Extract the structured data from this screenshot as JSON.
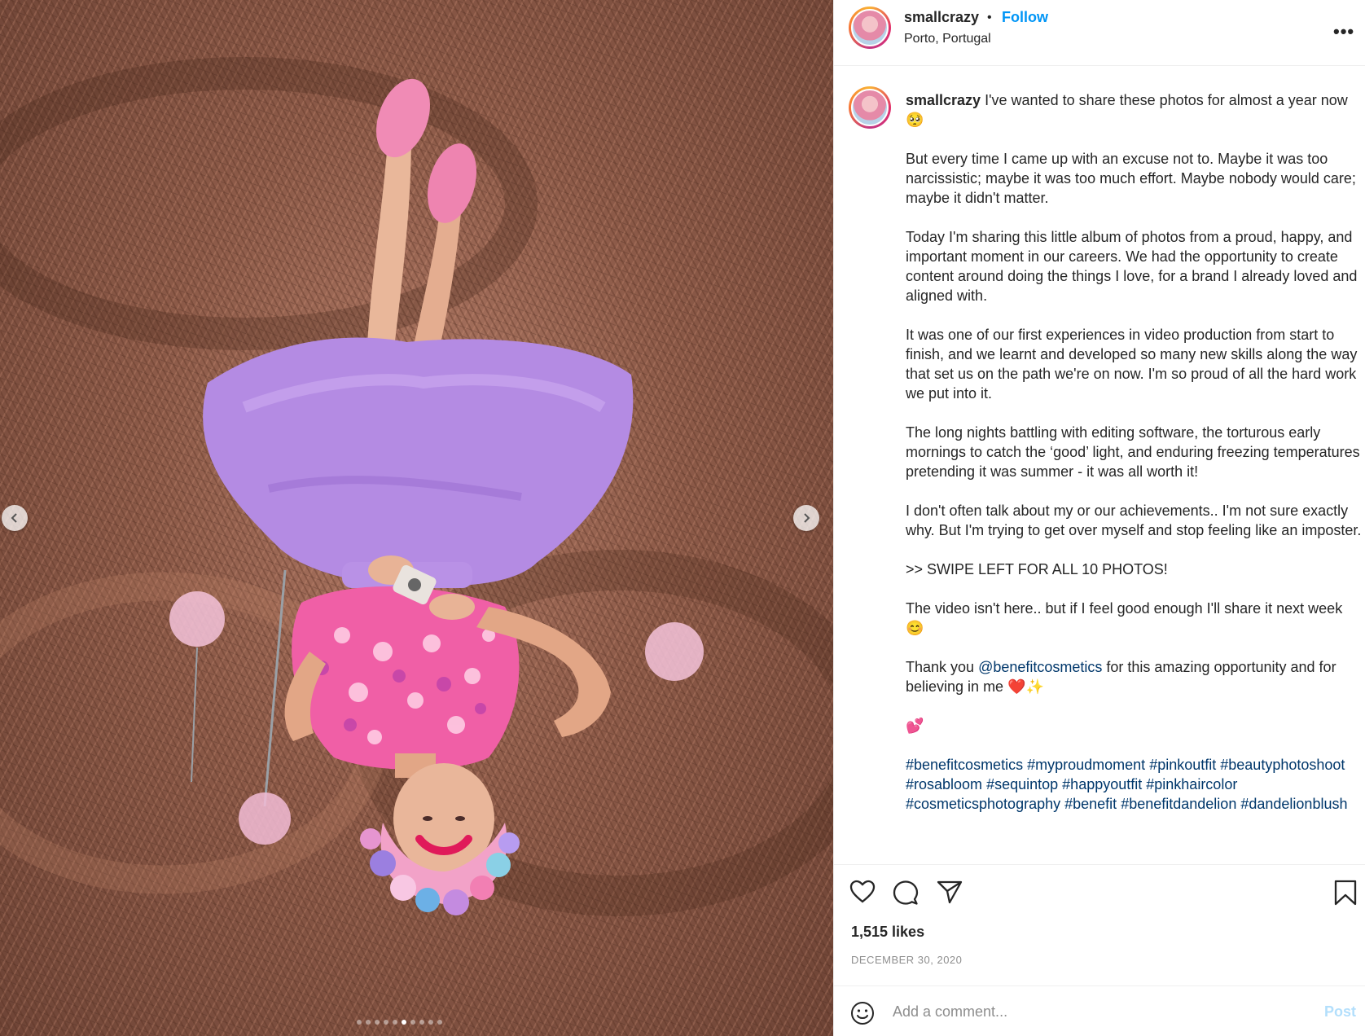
{
  "post": {
    "username": "smallcrazy",
    "separator": "•",
    "follow_label": "Follow",
    "location": "Porto, Portugal",
    "more_label": "•••",
    "caption": {
      "username": "smallcrazy",
      "paragraphs": [
        "I've wanted to share these photos for almost a year now 🥺",
        "But every time I came up with an excuse not to. Maybe it was too narcissistic; maybe it was too much effort. Maybe nobody would care; maybe it didn't matter.",
        "Today I'm sharing this little album of photos from a proud, happy, and important moment in our careers. We had the opportunity to create content around doing the things I love, for a brand I already loved and aligned with.",
        "It was one of our first experiences in video production from start to finish, and we learnt and developed so many new skills along the way that set us on the path we're on now. I'm so proud of all the hard work we put into it.",
        "The long nights battling with editing software, the torturous early mornings to catch the ‘good’ light, and enduring freezing temperatures pretending it was summer - it was all worth it!",
        "I don't often talk about my or our achievements.. I'm not sure exactly why. But I'm trying to get over myself and stop feeling like an imposter.",
        ">> SWIPE LEFT FOR ALL 10 PHOTOS!",
        "The video isn't here.. but if I feel good enough I'll share it next week 😊"
      ],
      "thanks_prefix": "Thank you ",
      "thanks_mention": "@benefitcosmetics",
      "thanks_suffix": " for this amazing opportunity and for believing in me ❤️✨",
      "hearts": "💕",
      "hashtags": [
        "#benefitcosmetics",
        "#myproudmoment",
        "#pinkoutfit",
        "#beautyphotoshoot",
        "#rosabloom",
        "#sequintop",
        "#happyoutfit",
        "#pinkhaircolor",
        "#cosmeticsphotography",
        "#benefit",
        "#benefitdandelion",
        "#dandelionblush"
      ]
    },
    "likes": "1,515 likes",
    "date": "DECEMBER 30, 2020",
    "comment": {
      "placeholder": "Add a comment...",
      "post_label": "Post"
    },
    "carousel": {
      "total": 10,
      "active_index": 5
    }
  },
  "icons": {
    "like": "heart-icon",
    "comment": "comment-icon",
    "share": "paper-plane-icon",
    "save": "bookmark-icon",
    "emoji": "smiley-icon",
    "prev": "chevron-left-icon",
    "next": "chevron-right-icon"
  },
  "colors": {
    "follow": "#0095f6",
    "link": "#00376b",
    "post_disabled": "#b3dffc",
    "muted": "#8e8e8e",
    "text": "#262626"
  }
}
